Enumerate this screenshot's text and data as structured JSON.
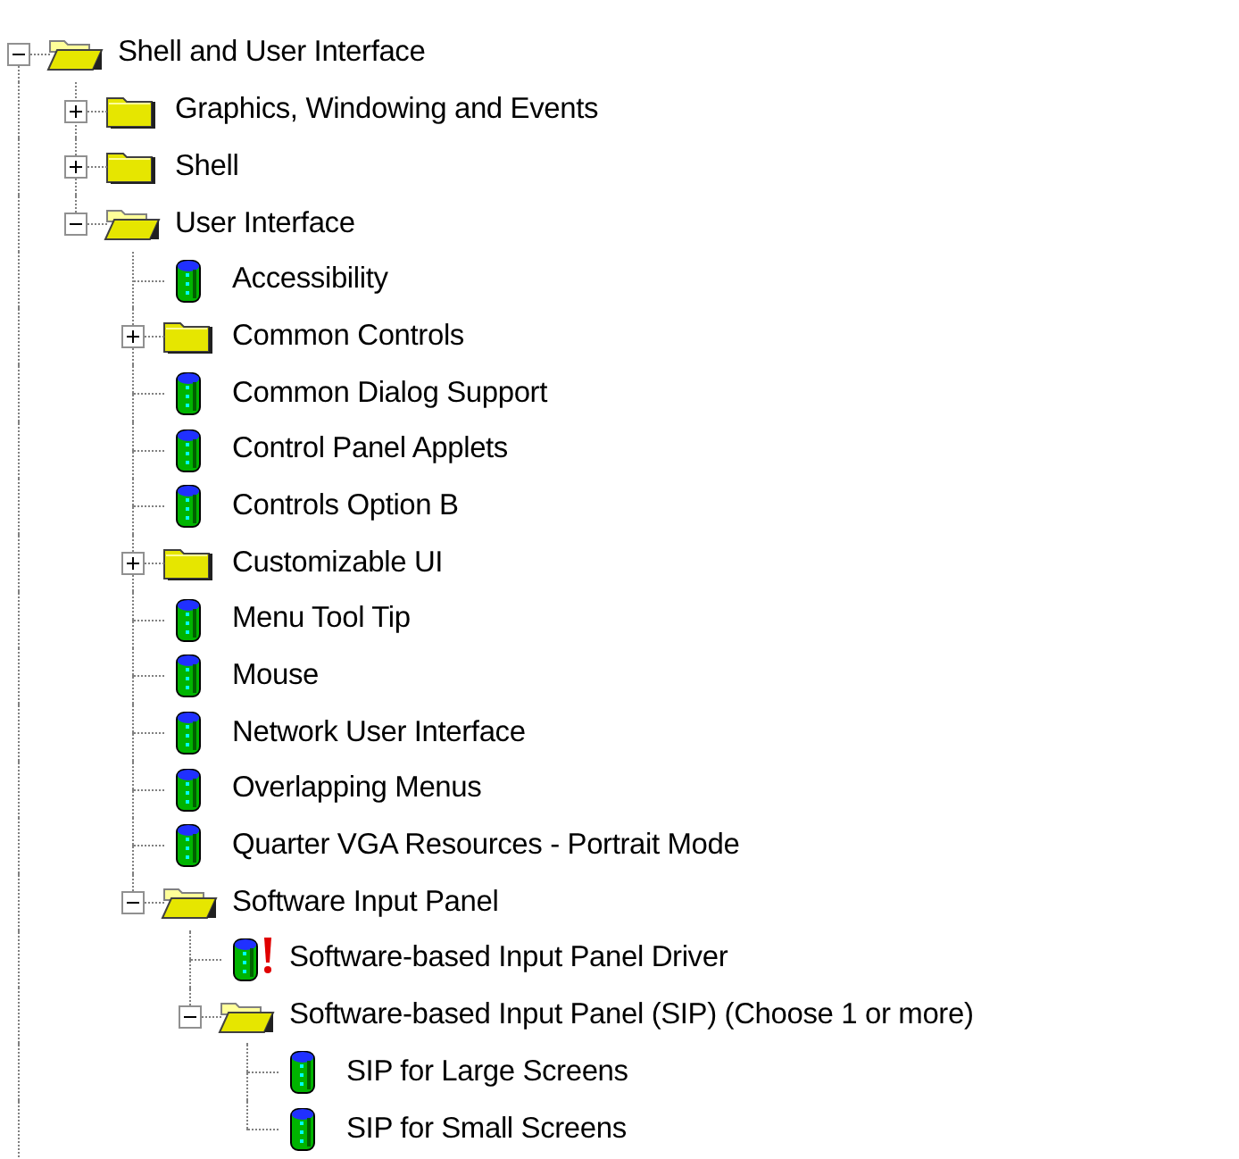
{
  "tree": [
    {
      "label": "Shell and User Interface",
      "kind": "folder",
      "expanded": true,
      "children": [
        {
          "label": "Graphics, Windowing and Events",
          "kind": "folder",
          "expanded": false
        },
        {
          "label": "Shell",
          "kind": "folder",
          "expanded": false
        },
        {
          "label": "User Interface",
          "kind": "folder",
          "expanded": true,
          "children": [
            {
              "label": "Accessibility",
              "kind": "component",
              "warning": false
            },
            {
              "label": "Common Controls",
              "kind": "folder",
              "expanded": false
            },
            {
              "label": "Common Dialog Support",
              "kind": "component",
              "warning": false
            },
            {
              "label": "Control Panel Applets",
              "kind": "component",
              "warning": false
            },
            {
              "label": "Controls Option B",
              "kind": "component",
              "warning": false
            },
            {
              "label": "Customizable UI",
              "kind": "folder",
              "expanded": false
            },
            {
              "label": "Menu Tool Tip",
              "kind": "component",
              "warning": false
            },
            {
              "label": "Mouse",
              "kind": "component",
              "warning": false
            },
            {
              "label": "Network User Interface",
              "kind": "component",
              "warning": false
            },
            {
              "label": "Overlapping Menus",
              "kind": "component",
              "warning": false
            },
            {
              "label": "Quarter VGA Resources - Portrait Mode",
              "kind": "component",
              "warning": false
            },
            {
              "label": "Software Input Panel",
              "kind": "folder",
              "expanded": true,
              "children": [
                {
                  "label": "Software-based Input Panel Driver",
                  "kind": "component",
                  "warning": true
                },
                {
                  "label": "Software-based Input Panel (SIP) (Choose 1 or more)",
                  "kind": "folder",
                  "expanded": true,
                  "children": [
                    {
                      "label": "SIP for Large Screens",
                      "kind": "component",
                      "warning": false
                    },
                    {
                      "label": "SIP for Small Screens",
                      "kind": "component",
                      "warning": false
                    }
                  ]
                }
              ]
            }
          ]
        }
      ]
    }
  ]
}
